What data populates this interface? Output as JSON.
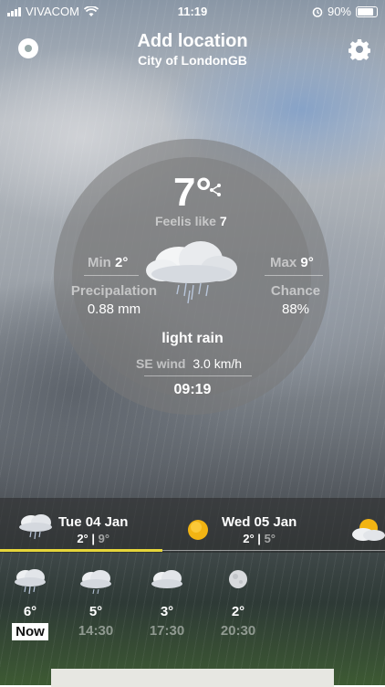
{
  "status_bar": {
    "carrier": "VIVACOM",
    "time": "11:19",
    "battery": "90%"
  },
  "header": {
    "title": "Add location",
    "subtitle": "City of LondonGB"
  },
  "current": {
    "temperature": "7°",
    "feels_label": "Feelis like",
    "feels_value": "7",
    "min_label": "Min",
    "min_value": "2°",
    "max_label": "Max",
    "max_value": "9°",
    "precip_label": "Precipalation",
    "precip_value": "0.88 mm",
    "chance_label": "Chance",
    "chance_value": "88%",
    "condition": "light rain",
    "wind_label": "SE wind",
    "wind_value": "3.0 km/h",
    "time": "09:19"
  },
  "days": [
    {
      "label": "Tue 04 Jan",
      "high": "2°",
      "low": "9°",
      "icon": "rain-cloud-icon"
    },
    {
      "label": "Wed 05 Jan",
      "high": "2°",
      "low": "5°",
      "icon": "sun-icon"
    }
  ],
  "hours": [
    {
      "temp": "6°",
      "label": "Now",
      "icon": "rain-cloud-icon"
    },
    {
      "temp": "5°",
      "label": "14:30",
      "icon": "cloud-icon"
    },
    {
      "temp": "3°",
      "label": "17:30",
      "icon": "cloud-icon"
    },
    {
      "temp": "2°",
      "label": "20:30",
      "icon": "moon-icon"
    }
  ],
  "colors": {
    "accent": "#e6d53a"
  }
}
